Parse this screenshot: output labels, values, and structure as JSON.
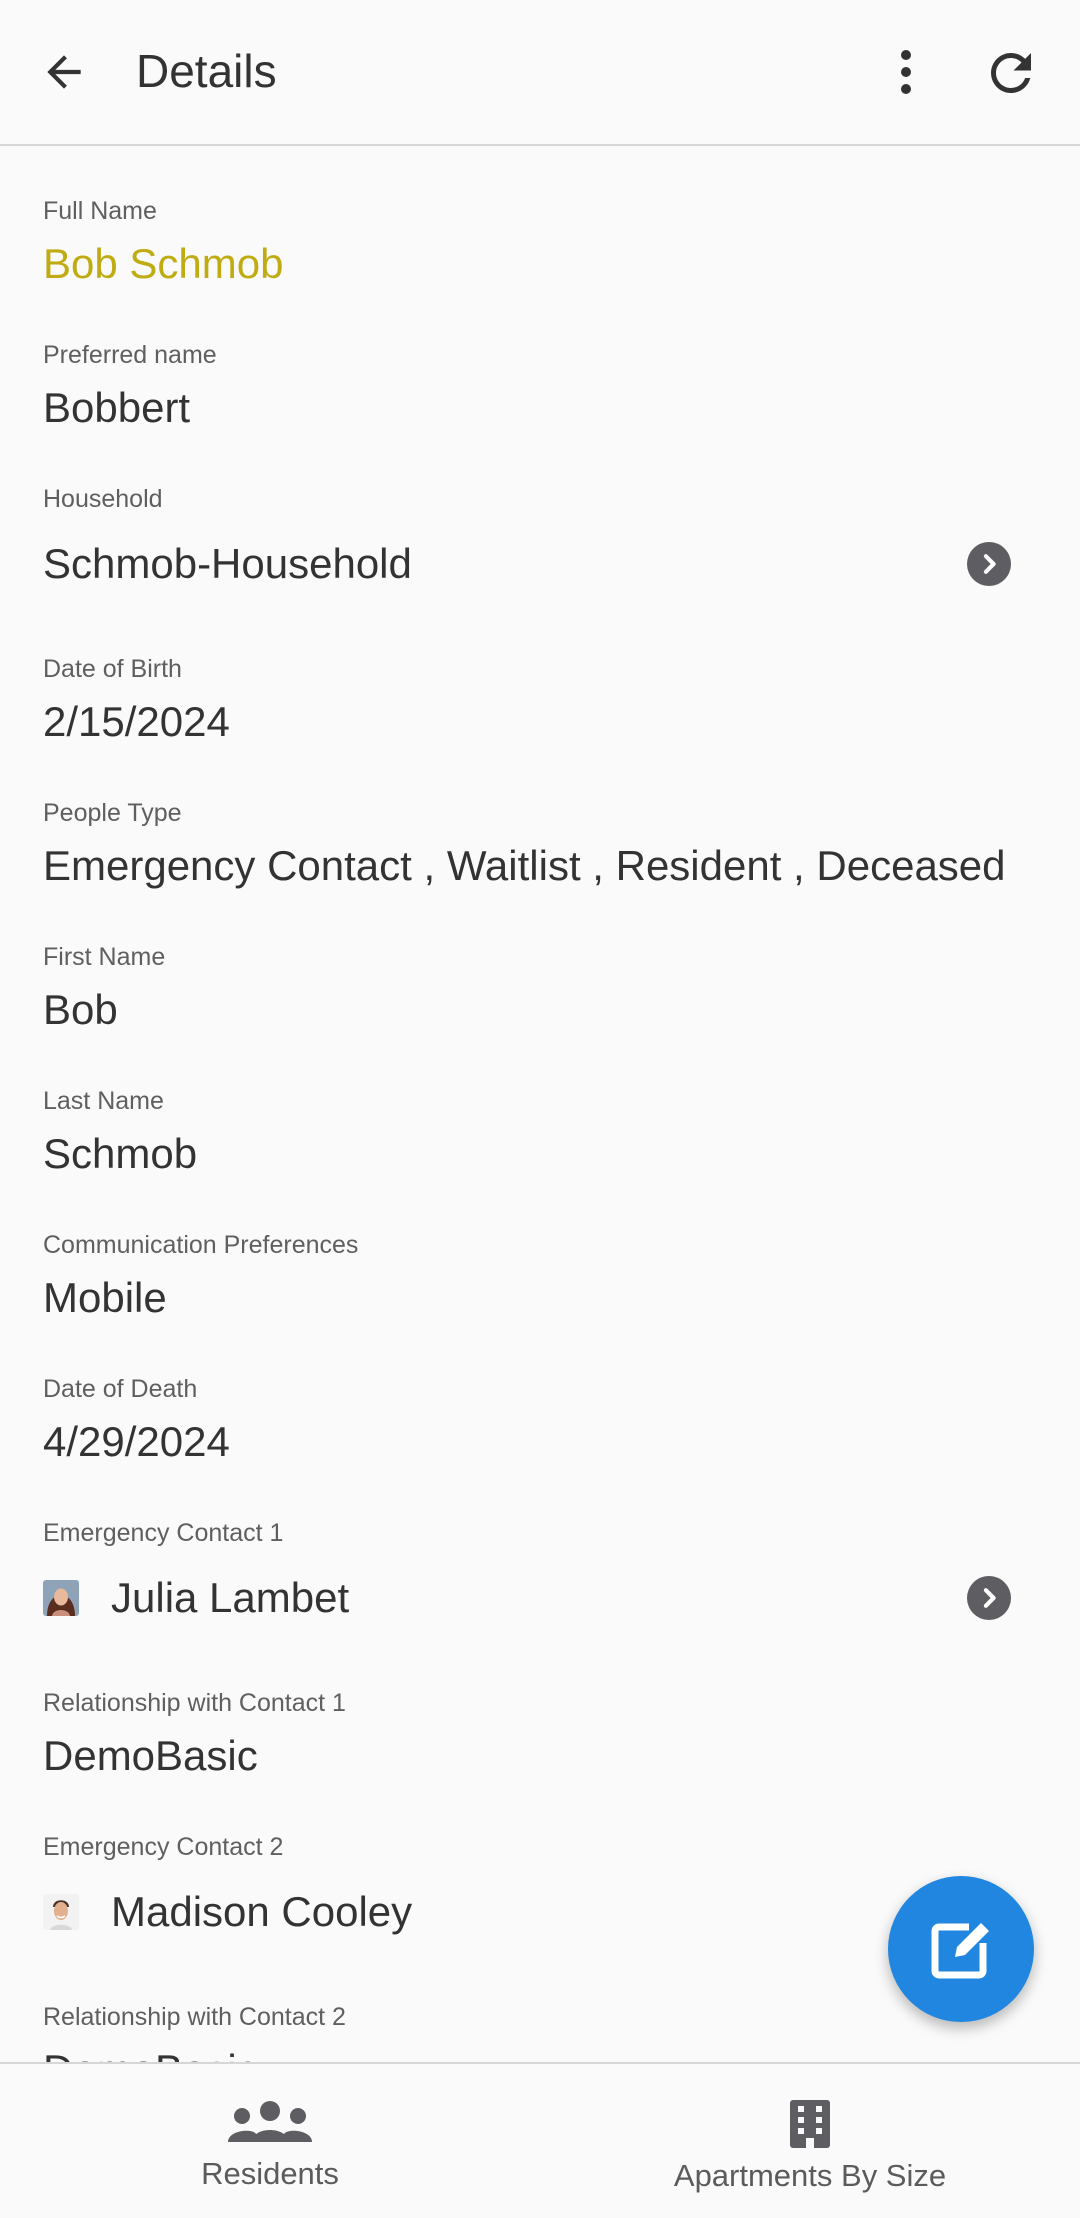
{
  "header": {
    "title": "Details",
    "back_icon": "arrow-left-icon",
    "more_icon": "more-vert-icon",
    "refresh_icon": "refresh-icon"
  },
  "fields": {
    "full_name": {
      "label": "Full Name",
      "value": "Bob Schmob",
      "color": "#c0ac12"
    },
    "preferred_name": {
      "label": "Preferred name",
      "value": "Bobbert"
    },
    "household": {
      "label": "Household",
      "value": "Schmob-Household"
    },
    "dob": {
      "label": "Date of Birth",
      "value": "2/15/2024"
    },
    "people_type": {
      "label": "People Type",
      "value": "Emergency Contact , Waitlist , Resident , Deceased"
    },
    "first_name": {
      "label": "First Name",
      "value": "Bob"
    },
    "last_name": {
      "label": "Last Name",
      "value": "Schmob"
    },
    "comm_prefs": {
      "label": "Communication Preferences",
      "value": "Mobile"
    },
    "dod": {
      "label": "Date of Death",
      "value": "4/29/2024"
    },
    "ec1": {
      "label": "Emergency Contact 1",
      "value": "Julia Lambet"
    },
    "rel1": {
      "label": "Relationship with Contact 1",
      "value": "DemoBasic"
    },
    "ec2": {
      "label": "Emergency Contact 2",
      "value": "Madison Cooley"
    },
    "rel2": {
      "label": "Relationship with Contact 2",
      "value": "DemoBasic"
    }
  },
  "fab": {
    "icon": "edit-icon",
    "color": "#2086e0"
  },
  "bottom_nav": {
    "residents": {
      "label": "Residents",
      "icon": "people-group-icon"
    },
    "apartments": {
      "label": "Apartments By Size",
      "icon": "building-icon"
    }
  }
}
